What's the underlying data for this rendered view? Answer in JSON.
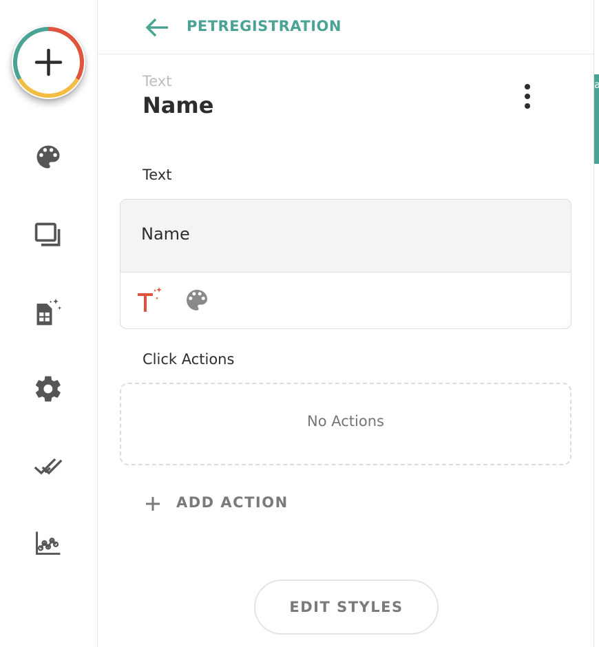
{
  "colors": {
    "accent": "#4aa394",
    "text_primary": "#2d2d2d",
    "text_muted": "#7a7a7a",
    "icon_gray": "#555555",
    "icon_red": "#e0533c",
    "ring_teal": "#4aa394",
    "ring_red": "#e0533c",
    "ring_yellow": "#f2bd42"
  },
  "rail": {
    "add_icon": "plus-icon",
    "items": [
      {
        "icon": "palette-icon"
      },
      {
        "icon": "screens-icon"
      },
      {
        "icon": "database-magic-icon"
      },
      {
        "icon": "gear-icon"
      },
      {
        "icon": "double-check-icon"
      },
      {
        "icon": "analytics-icon"
      }
    ]
  },
  "header": {
    "back_icon": "arrow-left-icon",
    "title": "PETREGISTRATION"
  },
  "component": {
    "type_label": "Text",
    "name": "Name",
    "more_icon": "more-vertical-icon"
  },
  "text_section": {
    "label": "Text",
    "value": "Name",
    "tools": [
      {
        "icon": "magic-text-icon"
      },
      {
        "icon": "palette-icon"
      }
    ]
  },
  "click_actions": {
    "label": "Click Actions",
    "empty_text": "No Actions",
    "add_label": "ADD ACTION"
  },
  "edit_styles_label": "EDIT STYLES",
  "edge_tab_text": "a"
}
